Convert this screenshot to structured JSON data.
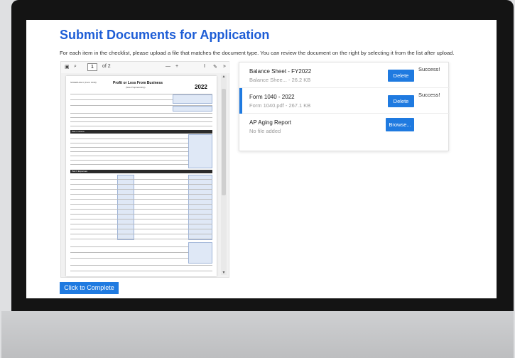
{
  "page": {
    "title": "Submit Documents for Application",
    "instructions": "For each item in the checklist, please upload a file that matches the document type. You can review the document on the right by selecting it from the list after upload."
  },
  "viewer": {
    "page_input": "1",
    "page_count": "of 2",
    "zoom_out": "—",
    "zoom_in": "+",
    "form_title": "Profit or Loss From Business",
    "form_subtitle": "(Sole Proprietorship)",
    "form_code": "SCHEDULE C (Form 1040)",
    "form_year": "2022",
    "part1": "Part I   Income",
    "part2": "Part II   Expenses"
  },
  "documents": [
    {
      "name": "Balance Sheet - FY2022",
      "file": "Balance Shee... - 26.2 KB",
      "button": "Delete",
      "status": "Success!",
      "selected": false
    },
    {
      "name": "Form 1040 - 2022",
      "file": "Form 1040.pdf - 267.1 KB",
      "button": "Delete",
      "status": "Success!",
      "selected": true
    },
    {
      "name": "AP Aging Report",
      "file": "No file added",
      "button": "Browse...",
      "status": "",
      "selected": false
    }
  ],
  "complete_button": "Click to Complete",
  "colors": {
    "accent": "#1f7ae0",
    "title": "#1d5dd6"
  },
  "icons": {
    "sidebar": "sidebar-toggle-icon",
    "search": "search-icon",
    "text": "text-select-icon",
    "draw": "pen-icon",
    "more": "chevron-double-right-icon"
  }
}
